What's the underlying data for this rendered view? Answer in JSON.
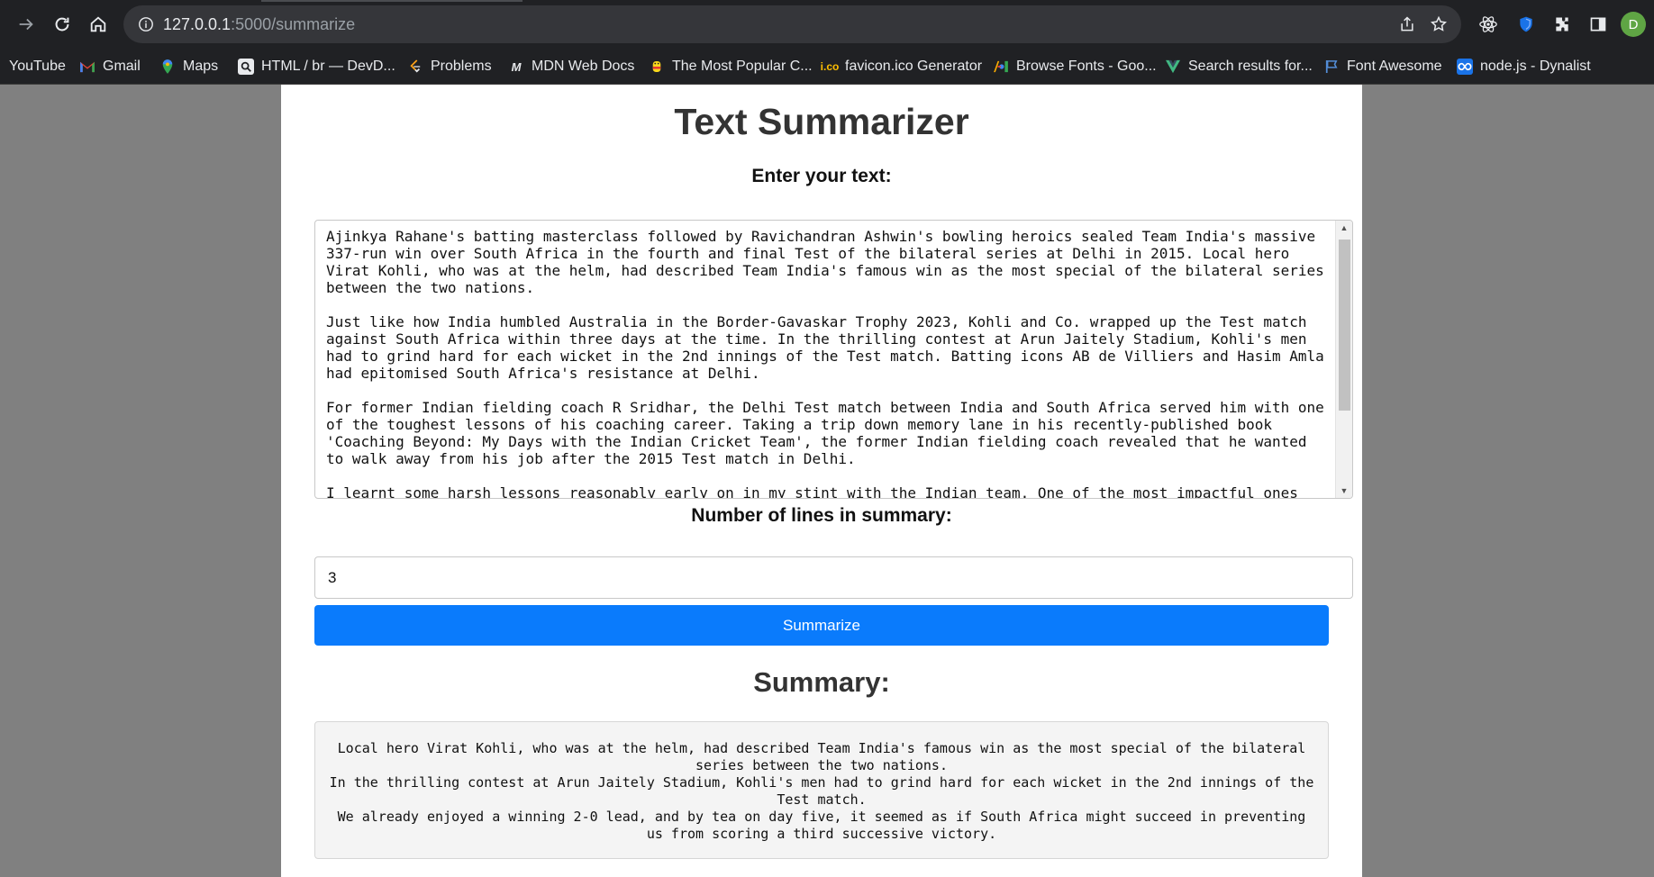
{
  "browser": {
    "url_host": "127.0.0.1",
    "url_path": ":5000/summarize",
    "profile_initial": "D",
    "bookmarks": [
      {
        "label": "YouTube",
        "icon": "youtube-icon"
      },
      {
        "label": "Gmail",
        "icon": "gmail-icon"
      },
      {
        "label": "Maps",
        "icon": "maps-icon"
      },
      {
        "label": "HTML / br — DevD...",
        "icon": "devdocs-icon"
      },
      {
        "label": "Problems",
        "icon": "leetcode-icon"
      },
      {
        "label": "MDN Web Docs",
        "icon": "mdn-icon"
      },
      {
        "label": "The Most Popular C...",
        "icon": "popular-icon"
      },
      {
        "label": "favicon.ico Generator",
        "icon": "favicon-icon"
      },
      {
        "label": "Browse Fonts - Goo...",
        "icon": "google-fonts-icon"
      },
      {
        "label": "Search results for...",
        "icon": "vuejs-icon"
      },
      {
        "label": "Font Awesome",
        "icon": "font-awesome-icon"
      },
      {
        "label": "node.js - Dynalist",
        "icon": "dynalist-icon"
      }
    ]
  },
  "page": {
    "title": "Text Summarizer",
    "input_label": "Enter your text:",
    "input_text": "Ajinkya Rahane's batting masterclass followed by Ravichandran Ashwin's bowling heroics sealed Team India's massive 337-run win over South Africa in the fourth and final Test of the bilateral series at Delhi in 2015. Local hero Virat Kohli, who was at the helm, had described Team India's famous win as the most special of the bilateral series between the two nations.\n\nJust like how India humbled Australia in the Border-Gavaskar Trophy 2023, Kohli and Co. wrapped up the Test match against South Africa within three days at the time. In the thrilling contest at Arun Jaitely Stadium, Kohli's men had to grind hard for each wicket in the 2nd innings of the Test match. Batting icons AB de Villiers and Hasim Amla had epitomised South Africa's resistance at Delhi.\n\nFor former Indian fielding coach R Sridhar, the Delhi Test match between India and South Africa served him with one of the toughest lessons of his coaching career. Taking a trip down memory lane in his recently-published book 'Coaching Beyond: My Days with the Indian Cricket Team', the former Indian fielding coach revealed that he wanted to walk away from his job after the 2015 Test match in Delhi.\n\nI learnt some harsh lessons reasonably early on in my stint with the Indian team. One of the most impactful ones came at",
    "lines_label": "Number of lines in summary:",
    "lines_value": "3",
    "button_label": "Summarize",
    "summary_heading": "Summary:",
    "summary_lines": [
      "Local hero Virat Kohli, who was at the helm, had described Team India's famous win as the most special of the bilateral series between the two nations.",
      "In the thrilling contest at Arun Jaitely Stadium, Kohli's men had to grind hard for each wicket in the 2nd innings of the Test match.",
      "We already enjoyed a winning 2-0 lead, and by tea on day five, it seemed as if South Africa might succeed in preventing us from scoring a third successive victory."
    ]
  },
  "colors": {
    "chrome_bg": "#202124",
    "button_blue": "#0a7bfc",
    "page_bg": "#808080"
  }
}
